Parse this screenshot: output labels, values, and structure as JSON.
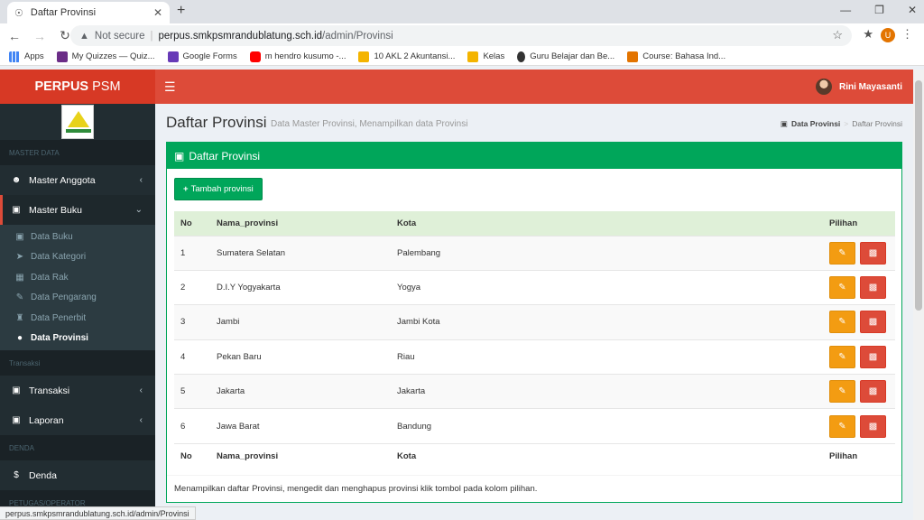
{
  "browser": {
    "tab_title": "Daftar Provinsi",
    "security_label": "Not secure",
    "url_host": "perpus.smkpsmrandublatung.sch.id",
    "url_path": "/admin/Provinsi",
    "profile_initial": "U",
    "bookmarks": [
      {
        "label": "Apps",
        "color": "#4285f4"
      },
      {
        "label": "My Quizzes — Quiz...",
        "color": "#6b2d87"
      },
      {
        "label": "Google Forms",
        "color": "#673ab7"
      },
      {
        "label": "m hendro kusumo -...",
        "color": "#ff0000"
      },
      {
        "label": "10 AKL 2 Akuntansi...",
        "color": "#f4b400"
      },
      {
        "label": "Kelas",
        "color": "#f4b400"
      },
      {
        "label": "Guru Belajar dan Be...",
        "color": "#333333"
      },
      {
        "label": "Course: Bahasa Ind...",
        "color": "#e37400"
      }
    ],
    "status_url": "perpus.smkpsmrandublatung.sch.id/admin/Provinsi"
  },
  "app": {
    "logo_bold": "PERPUS",
    "logo_rest": "PSM",
    "user_name": "Rini Mayasanti"
  },
  "sidebar": {
    "header_master": "MASTER DATA",
    "master_anggota": "Master Anggota",
    "master_buku": "Master Buku",
    "sub_items": [
      {
        "label": "Data Buku",
        "icon": "book-icon"
      },
      {
        "label": "Data Kategori",
        "icon": "tags-icon"
      },
      {
        "label": "Data Rak",
        "icon": "table-icon"
      },
      {
        "label": "Data Pengarang",
        "icon": "edit-icon"
      },
      {
        "label": "Data Penerbit",
        "icon": "building-icon"
      },
      {
        "label": "Data Provinsi",
        "icon": "globe-icon"
      }
    ],
    "header_transaksi": "Transaksi",
    "transaksi": "Transaksi",
    "laporan": "Laporan",
    "header_denda": "DENDA",
    "denda": "Denda",
    "header_petugas": "PETUGAS/OPERATOR"
  },
  "page": {
    "title": "Daftar Provinsi",
    "subtitle": "Data Master Provinsi, Menampilkan data Provinsi",
    "breadcrumb_1": "Data Provinsi",
    "breadcrumb_2": "Daftar Provinsi"
  },
  "box": {
    "title": "Daftar Provinsi",
    "add_button": "Tambah provinsi",
    "columns": [
      "No",
      "Nama_provinsi",
      "Kota",
      "Pilihan"
    ],
    "rows": [
      {
        "no": "1",
        "nama": "Sumatera Selatan",
        "kota": "Palembang"
      },
      {
        "no": "2",
        "nama": "D.I.Y Yogyakarta",
        "kota": "Yogya"
      },
      {
        "no": "3",
        "nama": "Jambi",
        "kota": "Jambi Kota"
      },
      {
        "no": "4",
        "nama": "Pekan Baru",
        "kota": "Riau"
      },
      {
        "no": "5",
        "nama": "Jakarta",
        "kota": "Jakarta"
      },
      {
        "no": "6",
        "nama": "Jawa Barat",
        "kota": "Bandung"
      }
    ],
    "footer_text": "Menampilkan daftar Provinsi, mengedit dan menghapus provinsi klik tombol pada kolom pilihan."
  },
  "colors": {
    "header_red": "#dd4b39",
    "success_green": "#00a65a",
    "warning_orange": "#f39c12",
    "danger_red": "#dd4b39",
    "sidebar_dark": "#222d32"
  }
}
